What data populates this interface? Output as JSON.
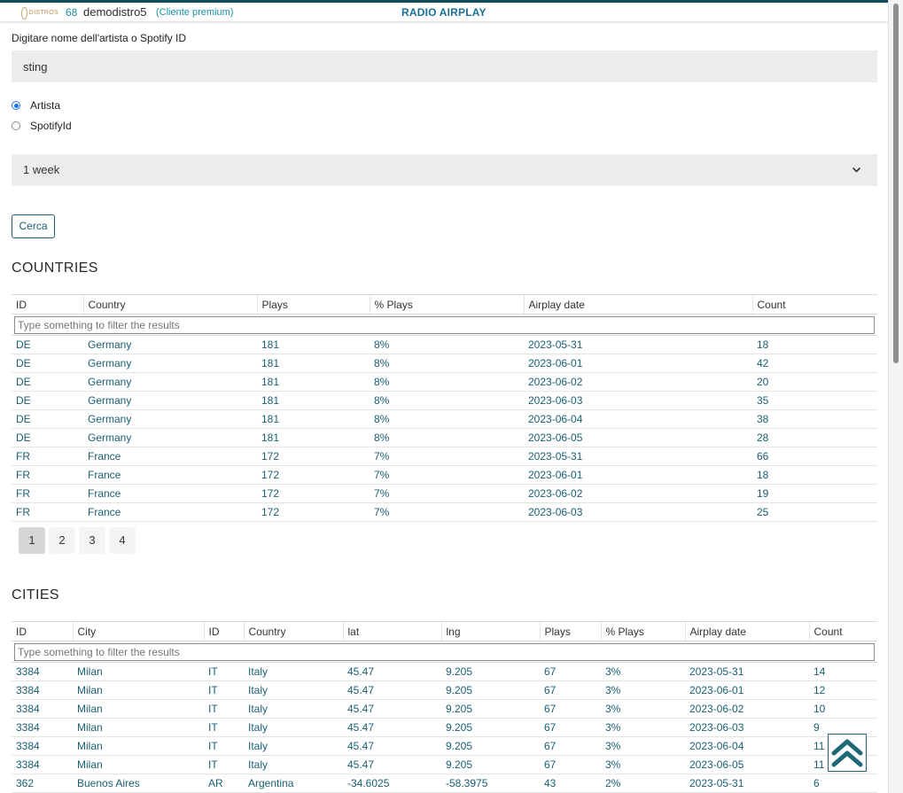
{
  "header": {
    "logo_text": "DISTROS",
    "number": "68",
    "user": "demodistro5",
    "badge": "(Cliente premium)",
    "title": "RADIO AIRPLAY"
  },
  "search": {
    "label": "Digitare nome dell'artista o Spotify ID",
    "value": "sting",
    "radio_options": [
      {
        "label": "Artista",
        "selected": true
      },
      {
        "label": "SpotifyId",
        "selected": false
      }
    ],
    "period": "1 week",
    "submit_label": "Cerca"
  },
  "countries": {
    "heading": "COUNTRIES",
    "columns": [
      "ID",
      "Country",
      "Plays",
      "% Plays",
      "Airplay date",
      "Count"
    ],
    "filter_placeholder": "Type something to filter the results",
    "rows": [
      [
        "DE",
        "Germany",
        "181",
        "8%",
        "2023-05-31",
        "18"
      ],
      [
        "DE",
        "Germany",
        "181",
        "8%",
        "2023-06-01",
        "42"
      ],
      [
        "DE",
        "Germany",
        "181",
        "8%",
        "2023-06-02",
        "20"
      ],
      [
        "DE",
        "Germany",
        "181",
        "8%",
        "2023-06-03",
        "35"
      ],
      [
        "DE",
        "Germany",
        "181",
        "8%",
        "2023-06-04",
        "38"
      ],
      [
        "DE",
        "Germany",
        "181",
        "8%",
        "2023-06-05",
        "28"
      ],
      [
        "FR",
        "France",
        "172",
        "7%",
        "2023-05-31",
        "66"
      ],
      [
        "FR",
        "France",
        "172",
        "7%",
        "2023-06-01",
        "18"
      ],
      [
        "FR",
        "France",
        "172",
        "7%",
        "2023-06-02",
        "19"
      ],
      [
        "FR",
        "France",
        "172",
        "7%",
        "2023-06-03",
        "25"
      ]
    ],
    "pages": [
      "1",
      "2",
      "3",
      "4"
    ],
    "active_page": "1"
  },
  "cities": {
    "heading": "CITIES",
    "columns": [
      "ID",
      "City",
      "ID",
      "Country",
      "lat",
      "lng",
      "Plays",
      "% Plays",
      "Airplay date",
      "Count"
    ],
    "filter_placeholder": "Type something to filter the results",
    "rows": [
      [
        "3384",
        "Milan",
        "IT",
        "Italy",
        "45.47",
        "9.205",
        "67",
        "3%",
        "2023-05-31",
        "14"
      ],
      [
        "3384",
        "Milan",
        "IT",
        "Italy",
        "45.47",
        "9.205",
        "67",
        "3%",
        "2023-06-01",
        "12"
      ],
      [
        "3384",
        "Milan",
        "IT",
        "Italy",
        "45.47",
        "9.205",
        "67",
        "3%",
        "2023-06-02",
        "10"
      ],
      [
        "3384",
        "Milan",
        "IT",
        "Italy",
        "45.47",
        "9.205",
        "67",
        "3%",
        "2023-06-03",
        "9"
      ],
      [
        "3384",
        "Milan",
        "IT",
        "Italy",
        "45.47",
        "9.205",
        "67",
        "3%",
        "2023-06-04",
        "11"
      ],
      [
        "3384",
        "Milan",
        "IT",
        "Italy",
        "45.47",
        "9.205",
        "67",
        "3%",
        "2023-06-05",
        "11"
      ],
      [
        "362",
        "Buenos Aires",
        "AR",
        "Argentina",
        "-34.6025",
        "-58.3975",
        "43",
        "2%",
        "2023-05-31",
        "6"
      ]
    ]
  },
  "icons": {
    "scroll_top": "double-chevron-up-icon",
    "select_chevron": "chevron-down-icon"
  },
  "colors": {
    "accent": "#1a5f73",
    "header_bar": "#0d4d57",
    "title": "#1a6f94"
  }
}
